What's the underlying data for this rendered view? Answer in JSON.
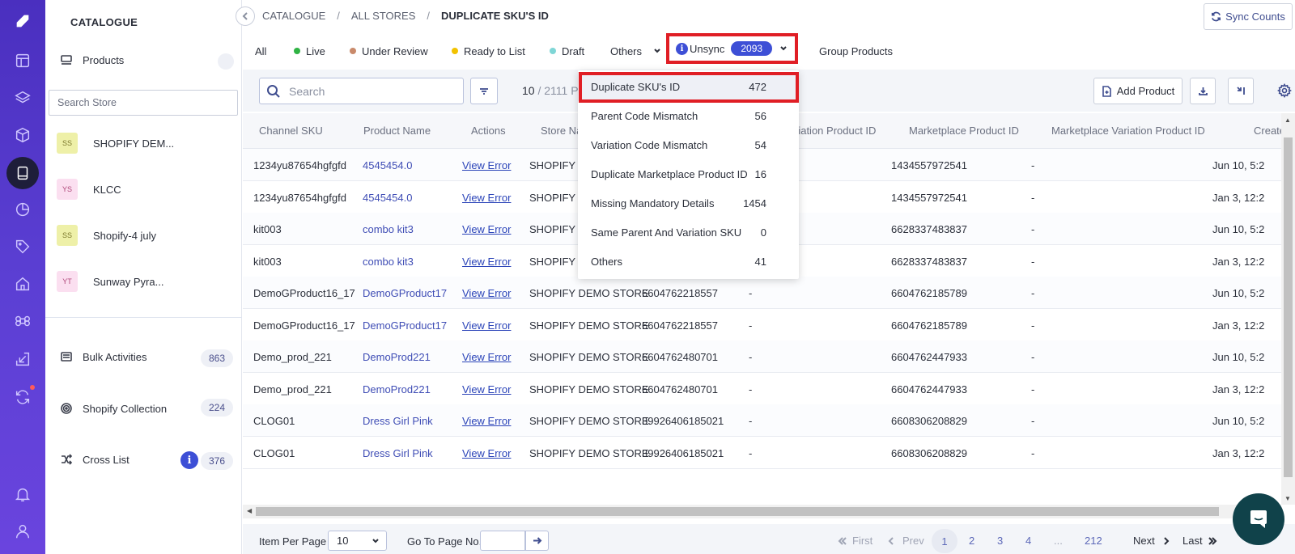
{
  "rail": {
    "items": [
      "logo",
      "dashboard",
      "layers",
      "box",
      "catalogue",
      "analytics",
      "tag",
      "home",
      "command",
      "import",
      "sync",
      "notification",
      "user"
    ]
  },
  "panel": {
    "title": "CATALOGUE",
    "products_label": "Products",
    "search_placeholder": "Search Store",
    "stores": [
      {
        "badge": "SS",
        "name": "SHOPIFY DEM...",
        "color": "#eef0a8",
        "text_color": "#7d7a2e"
      },
      {
        "badge": "YS",
        "name": "KLCC",
        "color": "#fbdff0",
        "text_color": "#b0487a"
      },
      {
        "badge": "SS",
        "name": "Shopify-4 july",
        "color": "#eef0a8",
        "text_color": "#7d7a2e"
      },
      {
        "badge": "YT",
        "name": "Sunway Pyra...",
        "color": "#fbdff0",
        "text_color": "#b0487a"
      }
    ],
    "bulk_activities": {
      "label": "Bulk Activities",
      "count": "863"
    },
    "shopify_collection": {
      "label": "Shopify Collection",
      "count": "224"
    },
    "cross_list": {
      "label": "Cross List",
      "count": "376",
      "info": "i"
    }
  },
  "breadcrumb": {
    "items": [
      "CATALOGUE",
      "ALL STORES",
      "DUPLICATE SKU'S ID"
    ],
    "separator": "/"
  },
  "sync_counts_label": "Sync Counts",
  "status_tabs": {
    "all": "All",
    "live": {
      "label": "Live",
      "color": "#2fb344"
    },
    "under_review": {
      "label": "Under Review",
      "color": "#c98a6b"
    },
    "ready_to_list": {
      "label": "Ready to List",
      "color": "#f2c200"
    },
    "draft": {
      "label": "Draft",
      "color": "#7fd6d6"
    },
    "others": "Others",
    "unsync": {
      "label": "Unsync",
      "count": "2093",
      "info": "i"
    },
    "group_products": "Group Products"
  },
  "toolbar": {
    "search_placeholder": "Search",
    "count_current": "10",
    "count_sep": " / ",
    "count_total": "2111 P",
    "add_product": "Add Product"
  },
  "dropdown": {
    "items": [
      {
        "label": "Duplicate SKU's ID",
        "count": "472"
      },
      {
        "label": "Parent Code Mismatch",
        "count": "56"
      },
      {
        "label": "Variation Code Mismatch",
        "count": "54"
      },
      {
        "label": "Duplicate Marketplace Product ID",
        "count": "16"
      },
      {
        "label": "Missing Mandatory Details",
        "count": "1454"
      },
      {
        "label": "Same Parent And Variation SKU",
        "count": "0"
      },
      {
        "label": "Others",
        "count": "41"
      }
    ]
  },
  "table": {
    "headers": [
      "Channel SKU",
      "Product Name",
      "Actions",
      "Store Na",
      "riation Product ID",
      "Marketplace Product ID",
      "Marketplace Variation Product ID",
      "Create"
    ],
    "rows": [
      [
        "1234yu87654hgfgfd",
        "4545454.0",
        "View Error",
        "SHOPIFY",
        "",
        "",
        "1434557972541",
        "-",
        "Jun 10, 5:2"
      ],
      [
        "1234yu87654hgfgfd",
        "4545454.0",
        "View Error",
        "SHOPIFY",
        "",
        "",
        "1434557972541",
        "-",
        "Jan 3, 12:2"
      ],
      [
        "kit003",
        "combo kit3",
        "View Error",
        "SHOPIFY",
        "",
        "",
        "6628337483837",
        "-",
        "Jun 10, 5:2"
      ],
      [
        "kit003",
        "combo kit3",
        "View Error",
        "SHOPIFY",
        "",
        "",
        "6628337483837",
        "-",
        "Jan 3, 12:2"
      ],
      [
        "DemoGProduct16_17",
        "DemoGProduct17",
        "View Error",
        "SHOPIFY DEMO STORE",
        "6604762218557",
        "-",
        "6604762185789",
        "-",
        "Jun 10, 5:2"
      ],
      [
        "DemoGProduct16_17",
        "DemoGProduct17",
        "View Error",
        "SHOPIFY DEMO STORE",
        "6604762218557",
        "-",
        "6604762185789",
        "-",
        "Jan 3, 12:2"
      ],
      [
        "Demo_prod_221",
        "DemoProd221",
        "View Error",
        "SHOPIFY DEMO STORE",
        "6604762480701",
        "-",
        "6604762447933",
        "-",
        "Jun 10, 5:2"
      ],
      [
        "Demo_prod_221",
        "DemoProd221",
        "View Error",
        "SHOPIFY DEMO STORE",
        "6604762480701",
        "-",
        "6604762447933",
        "-",
        "Jan 3, 12:2"
      ],
      [
        "CLOG01",
        "Dress Girl Pink",
        "View Error",
        "SHOPIFY DEMO STORE",
        "39926406185021",
        "-",
        "6608306208829",
        "-",
        "Jun 10, 5:2"
      ],
      [
        "CLOG01",
        "Dress Girl Pink",
        "View Error",
        "SHOPIFY DEMO STORE",
        "39926406185021",
        "-",
        "6608306208829",
        "-",
        "Jan 3, 12:2"
      ]
    ]
  },
  "footer": {
    "item_per_page_label": "Item Per Page",
    "item_per_page_value": "10",
    "go_to_label": "Go To Page No.",
    "first": "First",
    "prev": "Prev",
    "pages": [
      "1",
      "2",
      "3",
      "4",
      "...",
      "212"
    ],
    "current_page": "1",
    "next": "Next",
    "last": "Last"
  },
  "colors": {
    "accent": "#3d4fd6",
    "highlight": "#e01e25",
    "rail": "#5b3fd3",
    "chat": "#10424a"
  }
}
